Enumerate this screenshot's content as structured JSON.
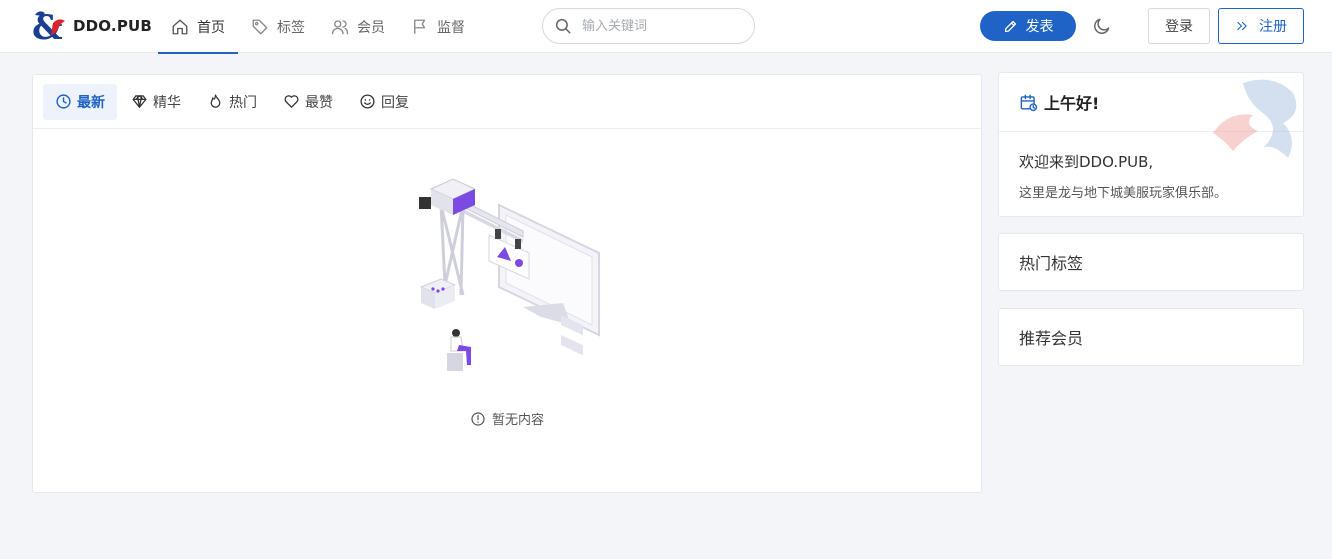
{
  "header": {
    "site_name": "DDO.PUB",
    "nav": [
      {
        "label": "首页",
        "icon": "home-icon",
        "active": true
      },
      {
        "label": "标签",
        "icon": "tag-icon",
        "active": false
      },
      {
        "label": "会员",
        "icon": "users-icon",
        "active": false
      },
      {
        "label": "监督",
        "icon": "flag-icon",
        "active": false
      }
    ],
    "search": {
      "placeholder": "输入关键词",
      "value": ""
    },
    "post_label": "发表",
    "login_label": "登录",
    "register_label": "注册"
  },
  "main": {
    "tabs": [
      {
        "label": "最新",
        "icon": "clock-icon",
        "active": true
      },
      {
        "label": "精华",
        "icon": "diamond-icon",
        "active": false
      },
      {
        "label": "热门",
        "icon": "flame-icon",
        "active": false
      },
      {
        "label": "最赞",
        "icon": "heart-icon",
        "active": false
      },
      {
        "label": "回复",
        "icon": "smile-icon",
        "active": false
      }
    ],
    "empty_text": "暂无内容"
  },
  "sidebar": {
    "greeting": "上午好!",
    "welcome_line1": "欢迎来到DDO.PUB,",
    "welcome_line2": "这里是龙与地下城美服玩家俱乐部。",
    "hot_tags_title": "热门标签",
    "recommended_members_title": "推荐会员"
  },
  "colors": {
    "accent": "#1e63c5",
    "background": "#f4f5f9",
    "illustration_purple": "#7b4ae2"
  }
}
